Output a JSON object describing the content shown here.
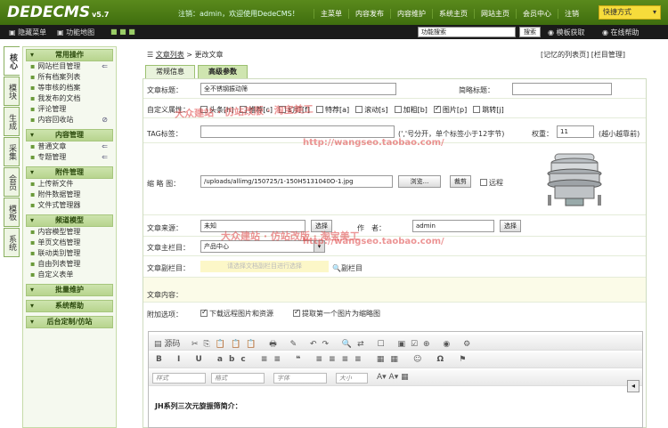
{
  "logo": {
    "text": "DEDECMS",
    "version": "v5.7"
  },
  "header": {
    "welcome": "注销：admin，欢迎使用DedeCMS！",
    "nav": [
      "主菜单",
      "内容发布",
      "内容维护",
      "系统主页",
      "网站主页",
      "会员中心",
      "注销"
    ],
    "quick": "快捷方式"
  },
  "subbar": {
    "hide_menu": "隐藏菜单",
    "function_map": "功能地图",
    "search_value": "功能搜索",
    "search_btn": "搜索",
    "template_get": "模板获取",
    "online_help": "在线帮助"
  },
  "vtabs": [
    "核心",
    "模块",
    "生成",
    "采集",
    "会员",
    "模板",
    "系统"
  ],
  "sidebar": [
    {
      "title": "常用操作",
      "items": [
        {
          "label": "网站栏目管理",
          "mark": "⇐"
        },
        {
          "label": "所有档案列表"
        },
        {
          "label": "等审核的档案"
        },
        {
          "label": "我发布的文档"
        },
        {
          "label": "评论管理"
        },
        {
          "label": "内容回收站",
          "mark": "⊘"
        }
      ]
    },
    {
      "title": "内容管理",
      "items": [
        {
          "label": "普通文章",
          "mark": "⇐"
        },
        {
          "label": "专题管理",
          "mark": "⇐"
        }
      ]
    },
    {
      "title": "附件管理",
      "items": [
        {
          "label": "上传新文件"
        },
        {
          "label": "附件数据管理"
        },
        {
          "label": "文件式管理器"
        }
      ]
    },
    {
      "title": "频道模型",
      "items": [
        {
          "label": "内容模型管理"
        },
        {
          "label": "单页文档管理"
        },
        {
          "label": "联动类别管理"
        },
        {
          "label": "自由列表管理"
        },
        {
          "label": "自定义表单"
        }
      ]
    },
    {
      "title": "批量维护",
      "items": []
    },
    {
      "title": "系统帮助",
      "items": []
    },
    {
      "title": "后台定制/仿站",
      "items": []
    }
  ],
  "crumb": {
    "list": "文章列表",
    "sep": "> 更改文章"
  },
  "crumb_right": "[记忆的列表页]  [栏目管理]",
  "tabs": [
    "常规信息",
    "高级参数"
  ],
  "form": {
    "title_label": "文章标题：",
    "title_value": "全不锈钢振动筛",
    "short_title_label": "简略标题：",
    "attr_label": "自定义属性：",
    "attrs": [
      {
        "label": "头条[h]",
        "on": false
      },
      {
        "label": "推荐[c]",
        "on": false
      },
      {
        "label": "幻灯[f]",
        "on": false
      },
      {
        "label": "特荐[a]",
        "on": false
      },
      {
        "label": "滚动[s]",
        "on": false
      },
      {
        "label": "加粗[b]",
        "on": false
      },
      {
        "label": "图片[p]",
        "on": true
      },
      {
        "label": "跳转[j]",
        "on": false
      }
    ],
    "tag_label": "TAG标签：",
    "tag_hint": "(','号分开，单个标签小于12字节)",
    "weight_label": "权重：",
    "weight_value": "11",
    "weight_hint": "(越小越靠前)",
    "thumb_label": "缩 略 图：",
    "thumb_value": "/uploads/allimg/150725/1-150H5131040O-1.jpg",
    "browse": "浏览...",
    "crop": "裁剪",
    "remote": "远程",
    "source_label": "文章来源：",
    "source_value": "未知",
    "select1": "选择",
    "author_label": "作　者：",
    "author_value": "admin",
    "select2": "选择",
    "column_label": "文章主栏目：",
    "column_value": "产品中心",
    "subcolumn_label": "文章副栏目：",
    "subcolumn_hint": "请选择文档副栏目进行选择",
    "subcolumn_btn": "副栏目",
    "content_label": "文章内容：",
    "extra_label": "附加选项：",
    "download_remote": "下载远程图片和资源",
    "first_pic": "提取第一个图片为缩略图"
  },
  "watermark": {
    "line1": "大众建站 · 仿站改版 · 淘宝美工",
    "url": "http://wangseo.taobao.com/"
  },
  "editor": {
    "source": "源码",
    "style": "样式",
    "format": "格式",
    "font": "字体",
    "size": "大小",
    "content_heading": "JH系列三次元旋振筛简介："
  }
}
